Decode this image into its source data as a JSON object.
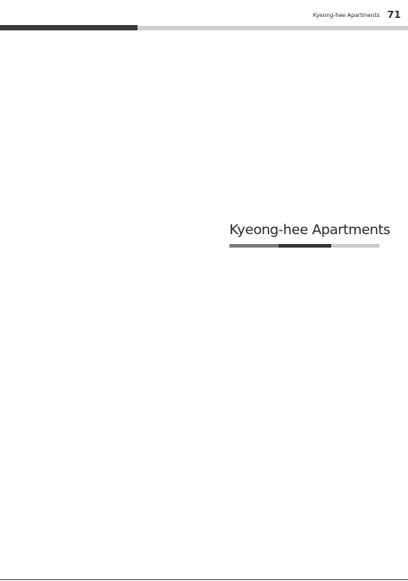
{
  "header": {
    "running_title": "Kyeong-hee Apartments",
    "page_number": "71"
  },
  "chapter": {
    "title": "Kyeong-hee Apartments"
  },
  "colors": {
    "header_rule_dark": "#3a3a3a",
    "header_rule_light": "#cfcfcf",
    "chapter_rule_mid": "#7a7a7a",
    "chapter_rule_dark": "#333333",
    "chapter_rule_light": "#cbcbcb",
    "text": "#2a2a2a"
  }
}
